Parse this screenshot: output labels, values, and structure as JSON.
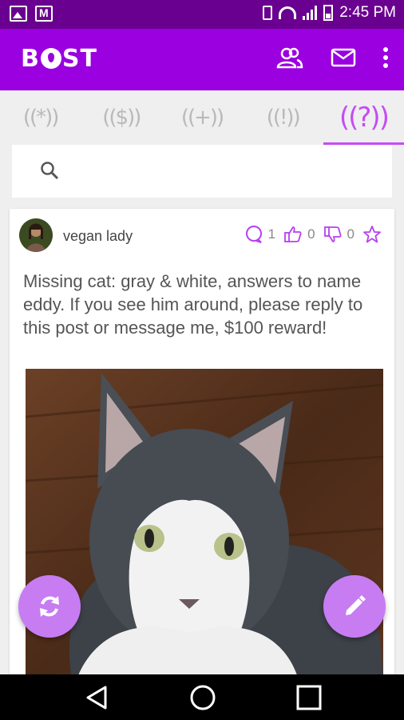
{
  "status_bar": {
    "time": "2:45 PM",
    "left_icons": [
      "gallery-icon",
      "gmail-icon"
    ],
    "right_icons": [
      "vibrate-icon",
      "wifi-icon",
      "data-icon",
      "signal-icon",
      "battery-icon"
    ]
  },
  "app_bar": {
    "logo_text": "BOST",
    "actions": [
      "people-icon",
      "mail-icon",
      "more-vert-icon"
    ]
  },
  "tabs": [
    {
      "label": "((*))",
      "active": false
    },
    {
      "label": "(($))",
      "active": false
    },
    {
      "label": "((+))",
      "active": false
    },
    {
      "label": "((!))",
      "active": false
    },
    {
      "label": "((?))",
      "active": true
    }
  ],
  "search": {
    "placeholder": ""
  },
  "post": {
    "author": "vegan lady",
    "comments": "1",
    "likes": "0",
    "dislikes": "0",
    "text": "Missing cat: gray & white, answers to name eddy. If you see him around, please reply to this post or message me, $100 reward!"
  },
  "colors": {
    "status_bar": "#6a008f",
    "app_bar": "#9a00e0",
    "accent": "#c54cf5",
    "fab": "#c77cf2"
  }
}
